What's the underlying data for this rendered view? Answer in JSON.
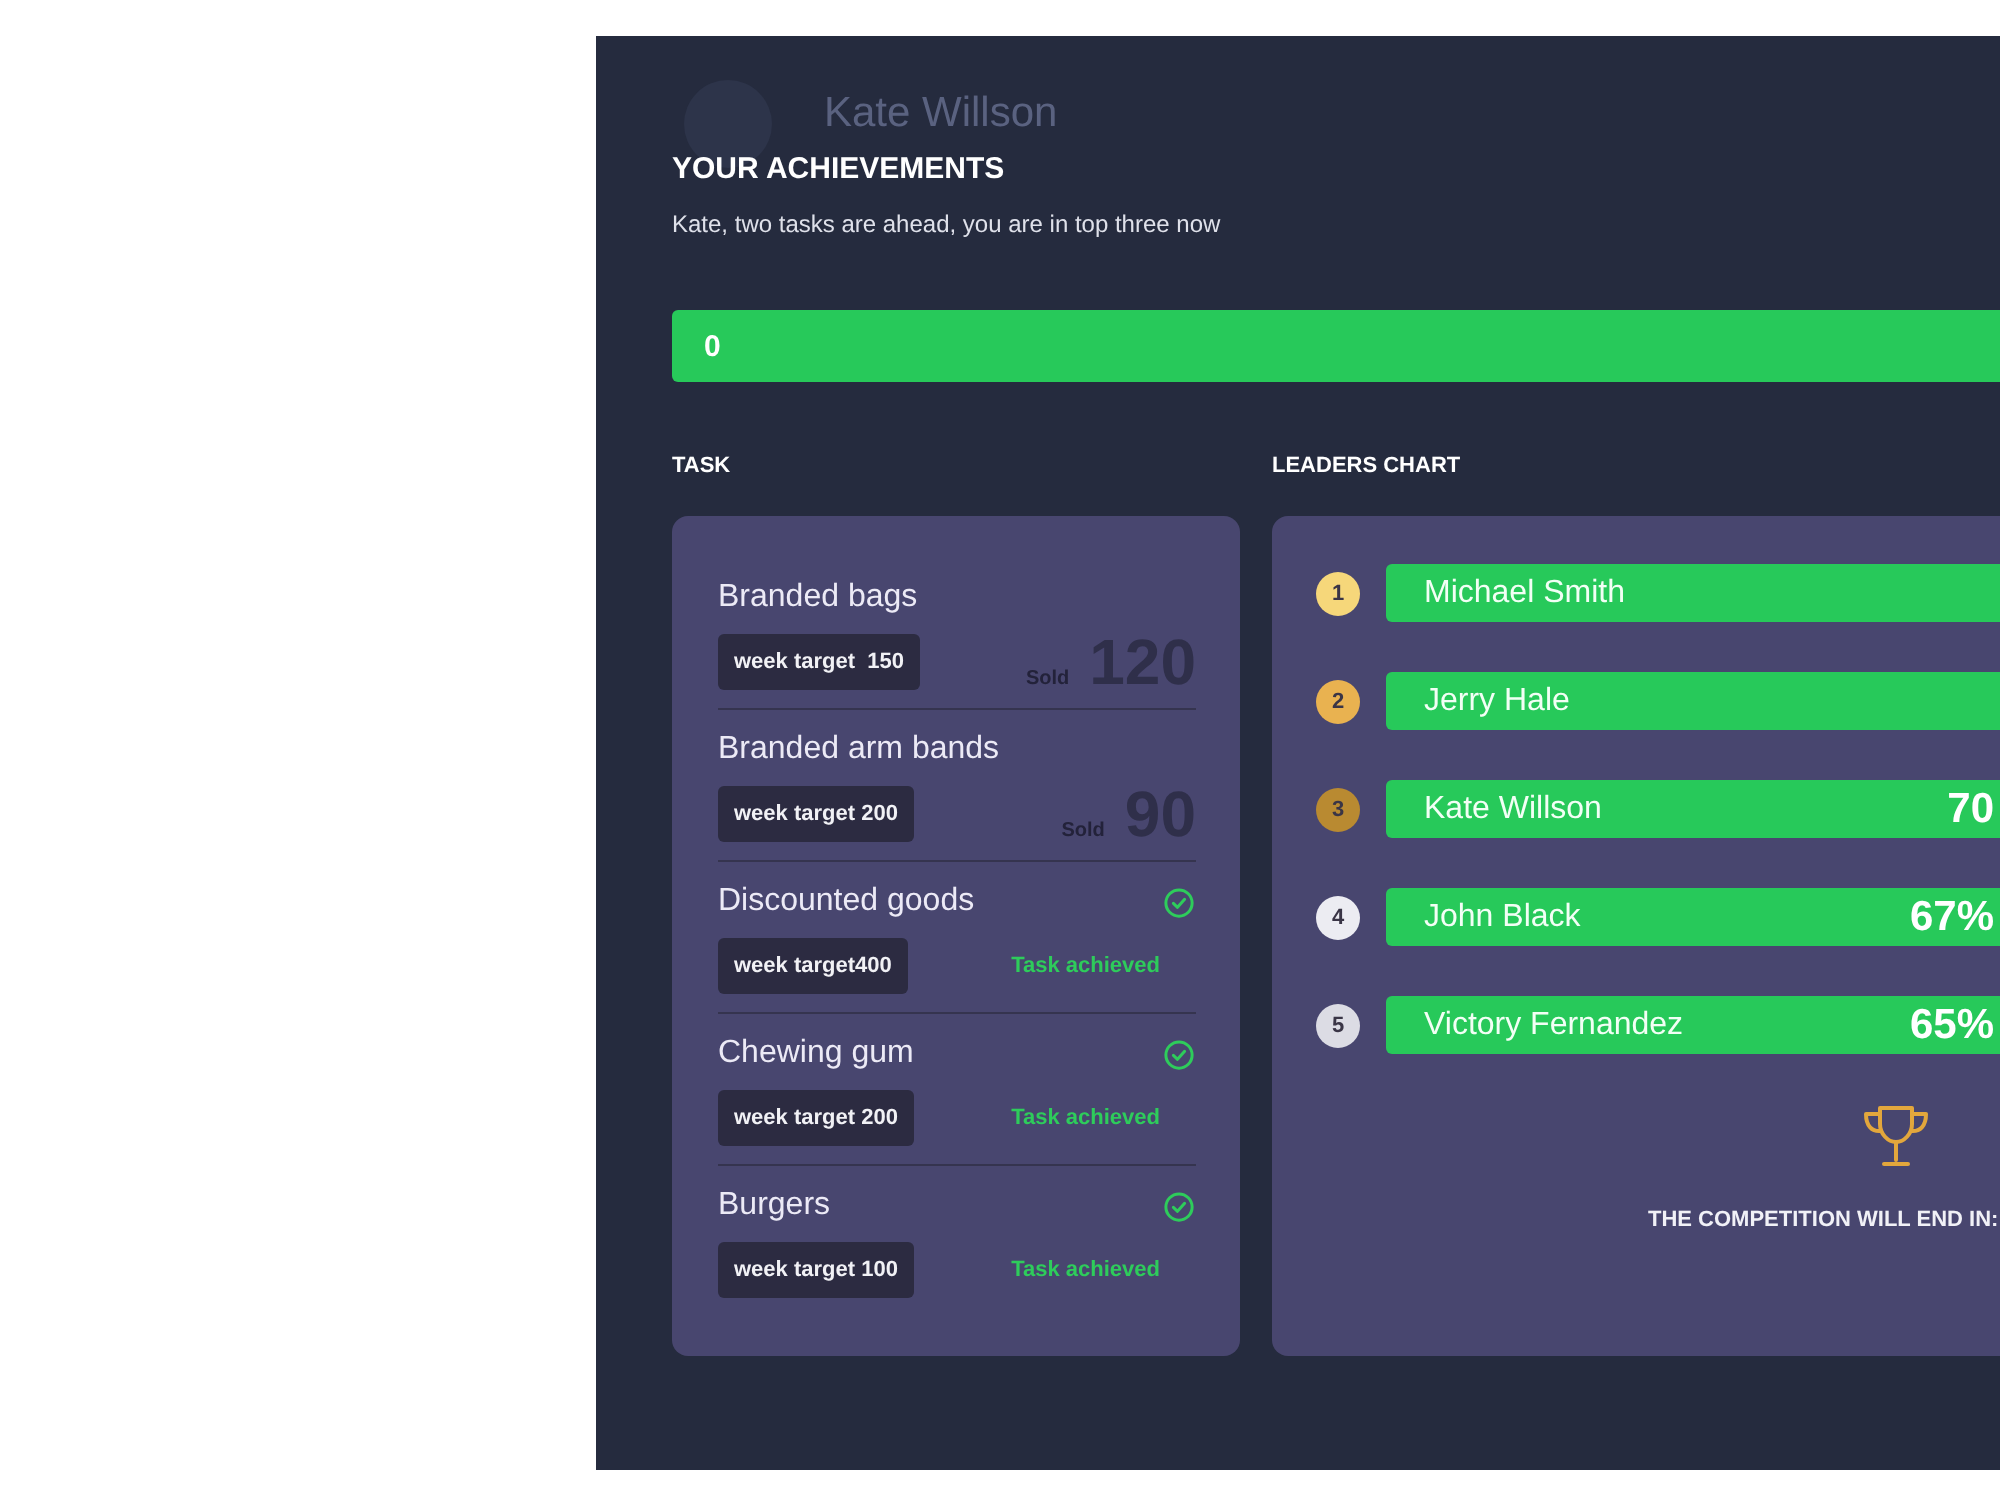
{
  "ghost_header": {
    "name": "Kate Willson"
  },
  "header": {
    "title": "YOUR ACHIEVEMENTS",
    "subtitle": "Kate, two tasks are ahead, you are in top three now"
  },
  "score_banner": {
    "label": "0"
  },
  "tasks": {
    "heading": "TASK",
    "items": [
      {
        "name": "Branded bags",
        "target": "week target  150",
        "achieved": false,
        "sold_label": "Sold",
        "sold": "120"
      },
      {
        "name": "Branded arm bands",
        "target": "week target 200",
        "achieved": false,
        "sold_label": "Sold",
        "sold": "90"
      },
      {
        "name": "Discounted goods",
        "target": "week target400",
        "achieved": true,
        "status": "Task achieved"
      },
      {
        "name": "Chewing gum",
        "target": "week target 200",
        "achieved": true,
        "status": "Task achieved"
      },
      {
        "name": "Burgers",
        "target": "week target 100",
        "achieved": true,
        "status": "Task achieved"
      }
    ]
  },
  "leaders": {
    "heading": "LEADERS CHART",
    "items": [
      {
        "rank": "1",
        "color": "#f6d77a",
        "name": "Michael Smith"
      },
      {
        "rank": "2",
        "color": "#e9b250",
        "name": "Jerry Hale"
      },
      {
        "rank": "3",
        "color": "#b98a31",
        "name": "Kate Willson",
        "percent": "70"
      },
      {
        "rank": "4",
        "color": "#ececf2",
        "name": "John Black",
        "percent": "67%"
      },
      {
        "rank": "5",
        "color": "#dcdce4",
        "name": "Victory Fernandez",
        "percent": "65%"
      }
    ],
    "footer": "THE COMPETITION WILL END IN:"
  }
}
